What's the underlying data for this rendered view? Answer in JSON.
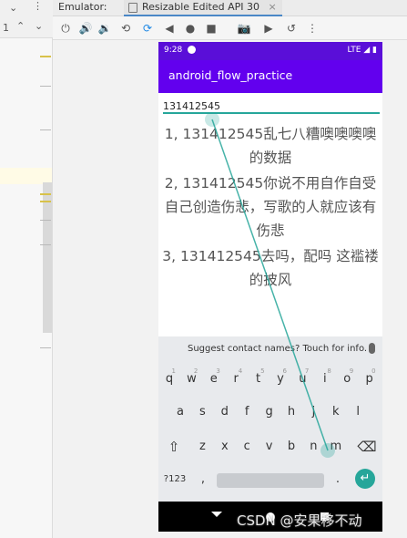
{
  "ide": {
    "line_number": "1"
  },
  "emulator": {
    "label": "Emulator:",
    "tab_title": "Resizable Edited API 30",
    "tab_close": "×"
  },
  "device": {
    "status_time": "9:28",
    "status_right": "LTE ◢ ▮",
    "app_title": "android_flow_practice",
    "input_value": "131412545",
    "results": [
      "1, 131412545乱七八糟噢噢噢噢的数据",
      "2, 131412545你说不用自作自受自己创造伤悲，写歌的人就应该有伤悲",
      "3, 131412545去吗，配吗 这褴褛的披风"
    ]
  },
  "keyboard": {
    "suggestion": "Suggest contact names? Touch for info.",
    "row1": [
      "q",
      "w",
      "e",
      "r",
      "t",
      "y",
      "u",
      "i",
      "o",
      "p"
    ],
    "row1_hints": [
      "1",
      "2",
      "3",
      "4",
      "5",
      "6",
      "7",
      "8",
      "9",
      "0"
    ],
    "row2": [
      "a",
      "s",
      "d",
      "f",
      "g",
      "h",
      "j",
      "k",
      "l"
    ],
    "row3": [
      "z",
      "x",
      "c",
      "v",
      "b",
      "n",
      "m"
    ],
    "shift": "⇧",
    "backspace": "⌫",
    "symbols": "?123",
    "comma": ",",
    "period": ".",
    "enter": "↵"
  },
  "watermark": "CSDN @安果移不动",
  "colors": {
    "status": "#5a0fd8",
    "appbar": "#6200ee",
    "accent": "#26a69a"
  }
}
